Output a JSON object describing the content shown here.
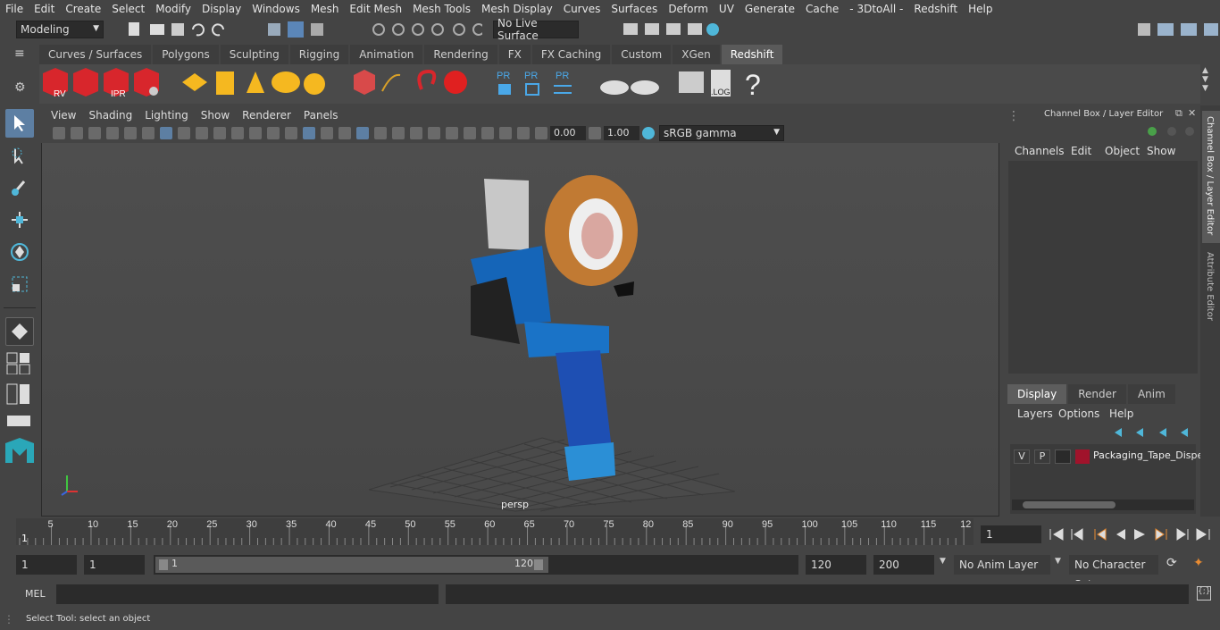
{
  "menubar": {
    "items": [
      "File",
      "Edit",
      "Create",
      "Select",
      "Modify",
      "Display",
      "Windows",
      "Mesh",
      "Edit Mesh",
      "Mesh Tools",
      "Mesh Display",
      "Curves",
      "Surfaces",
      "Deform",
      "UV",
      "Generate",
      "Cache",
      "- 3DtoAll -",
      "Redshift",
      "Help"
    ]
  },
  "statusline": {
    "mode": "Modeling",
    "live_surface": "No Live Surface"
  },
  "shelf": {
    "tabs": [
      "Curves / Surfaces",
      "Polygons",
      "Sculpting",
      "Rigging",
      "Animation",
      "Rendering",
      "FX",
      "FX Caching",
      "Custom",
      "XGen",
      "Redshift"
    ],
    "active_tab": "Redshift",
    "icon_labels": {
      "rv": "RV",
      "ipr": "IPR",
      "pr": "PR",
      "log": ".LOG",
      "help": "?"
    }
  },
  "viewport": {
    "menu": [
      "View",
      "Shading",
      "Lighting",
      "Show",
      "Renderer",
      "Panels"
    ],
    "exposure": "0.00",
    "gamma": "1.00",
    "color_space": "sRGB gamma",
    "camera_label": "persp"
  },
  "channel_box": {
    "title": "Channel Box / Layer Editor",
    "menu": [
      "Channels",
      "Edit",
      "Object",
      "Show"
    ]
  },
  "layer_editor": {
    "tabs": [
      "Display",
      "Render",
      "Anim"
    ],
    "active_tab": "Display",
    "menu": [
      "Layers",
      "Options",
      "Help"
    ],
    "layer": {
      "v": "V",
      "p": "P",
      "name": "Packaging_Tape_Dispe",
      "color": "#a0132b"
    }
  },
  "side_tabs": [
    "Channel Box / Layer Editor",
    "Attribute Editor"
  ],
  "timeline": {
    "ticks": [
      "5",
      "10",
      "15",
      "20",
      "25",
      "30",
      "35",
      "40",
      "45",
      "50",
      "55",
      "60",
      "65",
      "70",
      "75",
      "80",
      "85",
      "90",
      "95",
      "100",
      "105",
      "110",
      "115",
      "12"
    ],
    "current_marker": "1",
    "current_frame": "1"
  },
  "range": {
    "start": "1",
    "playback_start": "1",
    "slider_start": "1",
    "slider_end": "120",
    "playback_end": "120",
    "end": "200",
    "anim_layer": "No Anim Layer",
    "character_set": "No Character Set"
  },
  "command": {
    "label": "MEL"
  },
  "help_line": "Select Tool: select an object"
}
